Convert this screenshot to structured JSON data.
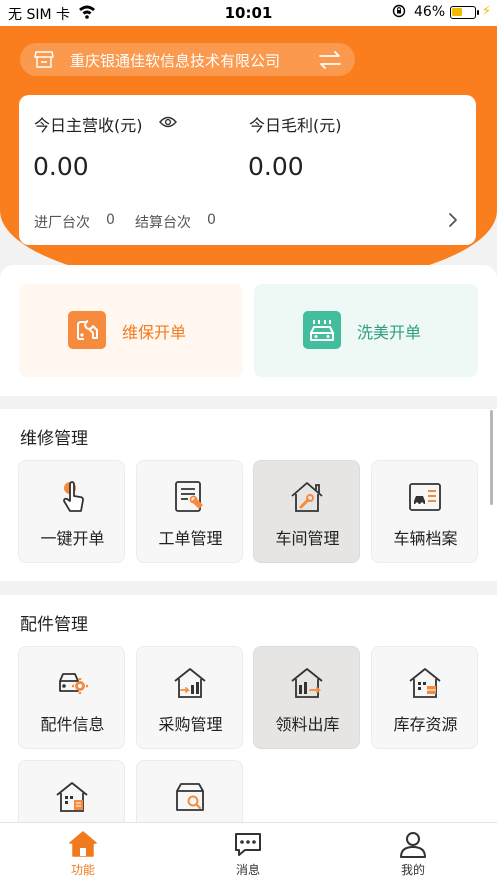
{
  "status_bar": {
    "carrier": "无 SIM 卡",
    "time": "10:01",
    "battery_percent": "46%",
    "battery_level": 0.46,
    "icons": [
      "wifi-icon",
      "orientation-lock-icon",
      "battery-icon",
      "charging-bolt-icon"
    ]
  },
  "header": {
    "company_name": "重庆银通佳软信息技术有限公司",
    "icons": [
      "shop-icon",
      "swap-icon"
    ]
  },
  "stats": {
    "revenue_label": "今日主营收(元)",
    "revenue_value": "0.00",
    "profit_label": "今日毛利(元)",
    "profit_value": "0.00",
    "entry_label": "进厂台次",
    "entry_count": "0",
    "settle_label": "结算台次",
    "settle_count": "0"
  },
  "quick_actions": [
    {
      "label": "维保开单",
      "icon": "wrench-car-icon"
    },
    {
      "label": "洗美开单",
      "icon": "car-wash-icon"
    }
  ],
  "repair_section": {
    "title": "维修管理",
    "items": [
      {
        "label": "一键开单",
        "icon": "tap-finger-icon"
      },
      {
        "label": "工单管理",
        "icon": "work-order-icon"
      },
      {
        "label": "车间管理",
        "icon": "workshop-icon"
      },
      {
        "label": "车辆档案",
        "icon": "vehicle-file-icon"
      }
    ]
  },
  "parts_section": {
    "title": "配件管理",
    "items": [
      {
        "label": "配件信息",
        "icon": "parts-info-icon"
      },
      {
        "label": "采购管理",
        "icon": "purchase-icon"
      },
      {
        "label": "领料出库",
        "icon": "outbound-icon"
      },
      {
        "label": "库存资源",
        "icon": "inventory-icon"
      },
      {
        "label": "",
        "icon": "warehouse-doc-icon"
      },
      {
        "label": "",
        "icon": "box-search-icon"
      }
    ]
  },
  "tabbar": {
    "items": [
      {
        "label": "功能",
        "icon": "home-icon",
        "active": true
      },
      {
        "label": "消息",
        "icon": "message-icon",
        "active": false
      },
      {
        "label": "我的",
        "icon": "user-icon",
        "active": false
      }
    ]
  },
  "colors": {
    "brand_orange": "#fa7e1e",
    "wash_green": "#42bd9d",
    "active_tile": "#e6e5e3"
  }
}
